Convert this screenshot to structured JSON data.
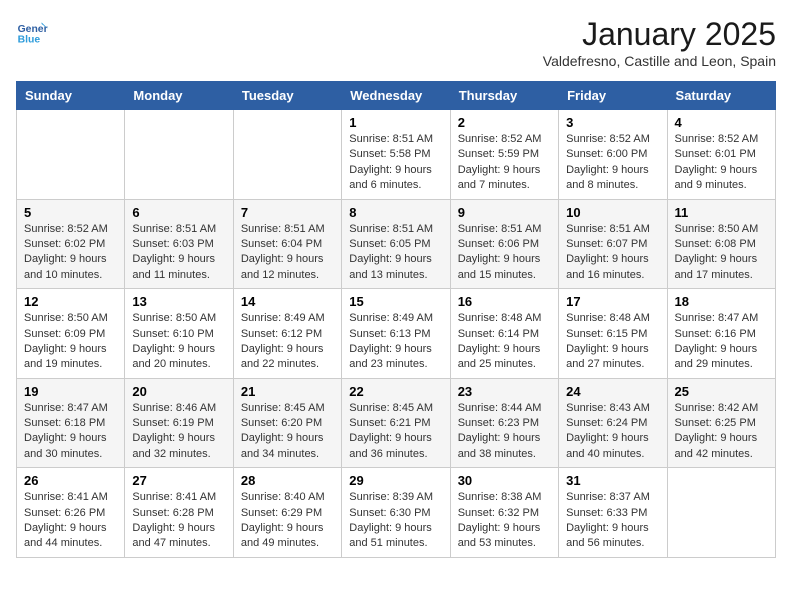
{
  "header": {
    "logo_line1": "General",
    "logo_line2": "Blue",
    "month": "January 2025",
    "location": "Valdefresno, Castille and Leon, Spain"
  },
  "days_of_week": [
    "Sunday",
    "Monday",
    "Tuesday",
    "Wednesday",
    "Thursday",
    "Friday",
    "Saturday"
  ],
  "weeks": [
    [
      {
        "day": "",
        "info": ""
      },
      {
        "day": "",
        "info": ""
      },
      {
        "day": "",
        "info": ""
      },
      {
        "day": "1",
        "info": "Sunrise: 8:51 AM\nSunset: 5:58 PM\nDaylight: 9 hours and 6 minutes."
      },
      {
        "day": "2",
        "info": "Sunrise: 8:52 AM\nSunset: 5:59 PM\nDaylight: 9 hours and 7 minutes."
      },
      {
        "day": "3",
        "info": "Sunrise: 8:52 AM\nSunset: 6:00 PM\nDaylight: 9 hours and 8 minutes."
      },
      {
        "day": "4",
        "info": "Sunrise: 8:52 AM\nSunset: 6:01 PM\nDaylight: 9 hours and 9 minutes."
      }
    ],
    [
      {
        "day": "5",
        "info": "Sunrise: 8:52 AM\nSunset: 6:02 PM\nDaylight: 9 hours and 10 minutes."
      },
      {
        "day": "6",
        "info": "Sunrise: 8:51 AM\nSunset: 6:03 PM\nDaylight: 9 hours and 11 minutes."
      },
      {
        "day": "7",
        "info": "Sunrise: 8:51 AM\nSunset: 6:04 PM\nDaylight: 9 hours and 12 minutes."
      },
      {
        "day": "8",
        "info": "Sunrise: 8:51 AM\nSunset: 6:05 PM\nDaylight: 9 hours and 13 minutes."
      },
      {
        "day": "9",
        "info": "Sunrise: 8:51 AM\nSunset: 6:06 PM\nDaylight: 9 hours and 15 minutes."
      },
      {
        "day": "10",
        "info": "Sunrise: 8:51 AM\nSunset: 6:07 PM\nDaylight: 9 hours and 16 minutes."
      },
      {
        "day": "11",
        "info": "Sunrise: 8:50 AM\nSunset: 6:08 PM\nDaylight: 9 hours and 17 minutes."
      }
    ],
    [
      {
        "day": "12",
        "info": "Sunrise: 8:50 AM\nSunset: 6:09 PM\nDaylight: 9 hours and 19 minutes."
      },
      {
        "day": "13",
        "info": "Sunrise: 8:50 AM\nSunset: 6:10 PM\nDaylight: 9 hours and 20 minutes."
      },
      {
        "day": "14",
        "info": "Sunrise: 8:49 AM\nSunset: 6:12 PM\nDaylight: 9 hours and 22 minutes."
      },
      {
        "day": "15",
        "info": "Sunrise: 8:49 AM\nSunset: 6:13 PM\nDaylight: 9 hours and 23 minutes."
      },
      {
        "day": "16",
        "info": "Sunrise: 8:48 AM\nSunset: 6:14 PM\nDaylight: 9 hours and 25 minutes."
      },
      {
        "day": "17",
        "info": "Sunrise: 8:48 AM\nSunset: 6:15 PM\nDaylight: 9 hours and 27 minutes."
      },
      {
        "day": "18",
        "info": "Sunrise: 8:47 AM\nSunset: 6:16 PM\nDaylight: 9 hours and 29 minutes."
      }
    ],
    [
      {
        "day": "19",
        "info": "Sunrise: 8:47 AM\nSunset: 6:18 PM\nDaylight: 9 hours and 30 minutes."
      },
      {
        "day": "20",
        "info": "Sunrise: 8:46 AM\nSunset: 6:19 PM\nDaylight: 9 hours and 32 minutes."
      },
      {
        "day": "21",
        "info": "Sunrise: 8:45 AM\nSunset: 6:20 PM\nDaylight: 9 hours and 34 minutes."
      },
      {
        "day": "22",
        "info": "Sunrise: 8:45 AM\nSunset: 6:21 PM\nDaylight: 9 hours and 36 minutes."
      },
      {
        "day": "23",
        "info": "Sunrise: 8:44 AM\nSunset: 6:23 PM\nDaylight: 9 hours and 38 minutes."
      },
      {
        "day": "24",
        "info": "Sunrise: 8:43 AM\nSunset: 6:24 PM\nDaylight: 9 hours and 40 minutes."
      },
      {
        "day": "25",
        "info": "Sunrise: 8:42 AM\nSunset: 6:25 PM\nDaylight: 9 hours and 42 minutes."
      }
    ],
    [
      {
        "day": "26",
        "info": "Sunrise: 8:41 AM\nSunset: 6:26 PM\nDaylight: 9 hours and 44 minutes."
      },
      {
        "day": "27",
        "info": "Sunrise: 8:41 AM\nSunset: 6:28 PM\nDaylight: 9 hours and 47 minutes."
      },
      {
        "day": "28",
        "info": "Sunrise: 8:40 AM\nSunset: 6:29 PM\nDaylight: 9 hours and 49 minutes."
      },
      {
        "day": "29",
        "info": "Sunrise: 8:39 AM\nSunset: 6:30 PM\nDaylight: 9 hours and 51 minutes."
      },
      {
        "day": "30",
        "info": "Sunrise: 8:38 AM\nSunset: 6:32 PM\nDaylight: 9 hours and 53 minutes."
      },
      {
        "day": "31",
        "info": "Sunrise: 8:37 AM\nSunset: 6:33 PM\nDaylight: 9 hours and 56 minutes."
      },
      {
        "day": "",
        "info": ""
      }
    ]
  ]
}
